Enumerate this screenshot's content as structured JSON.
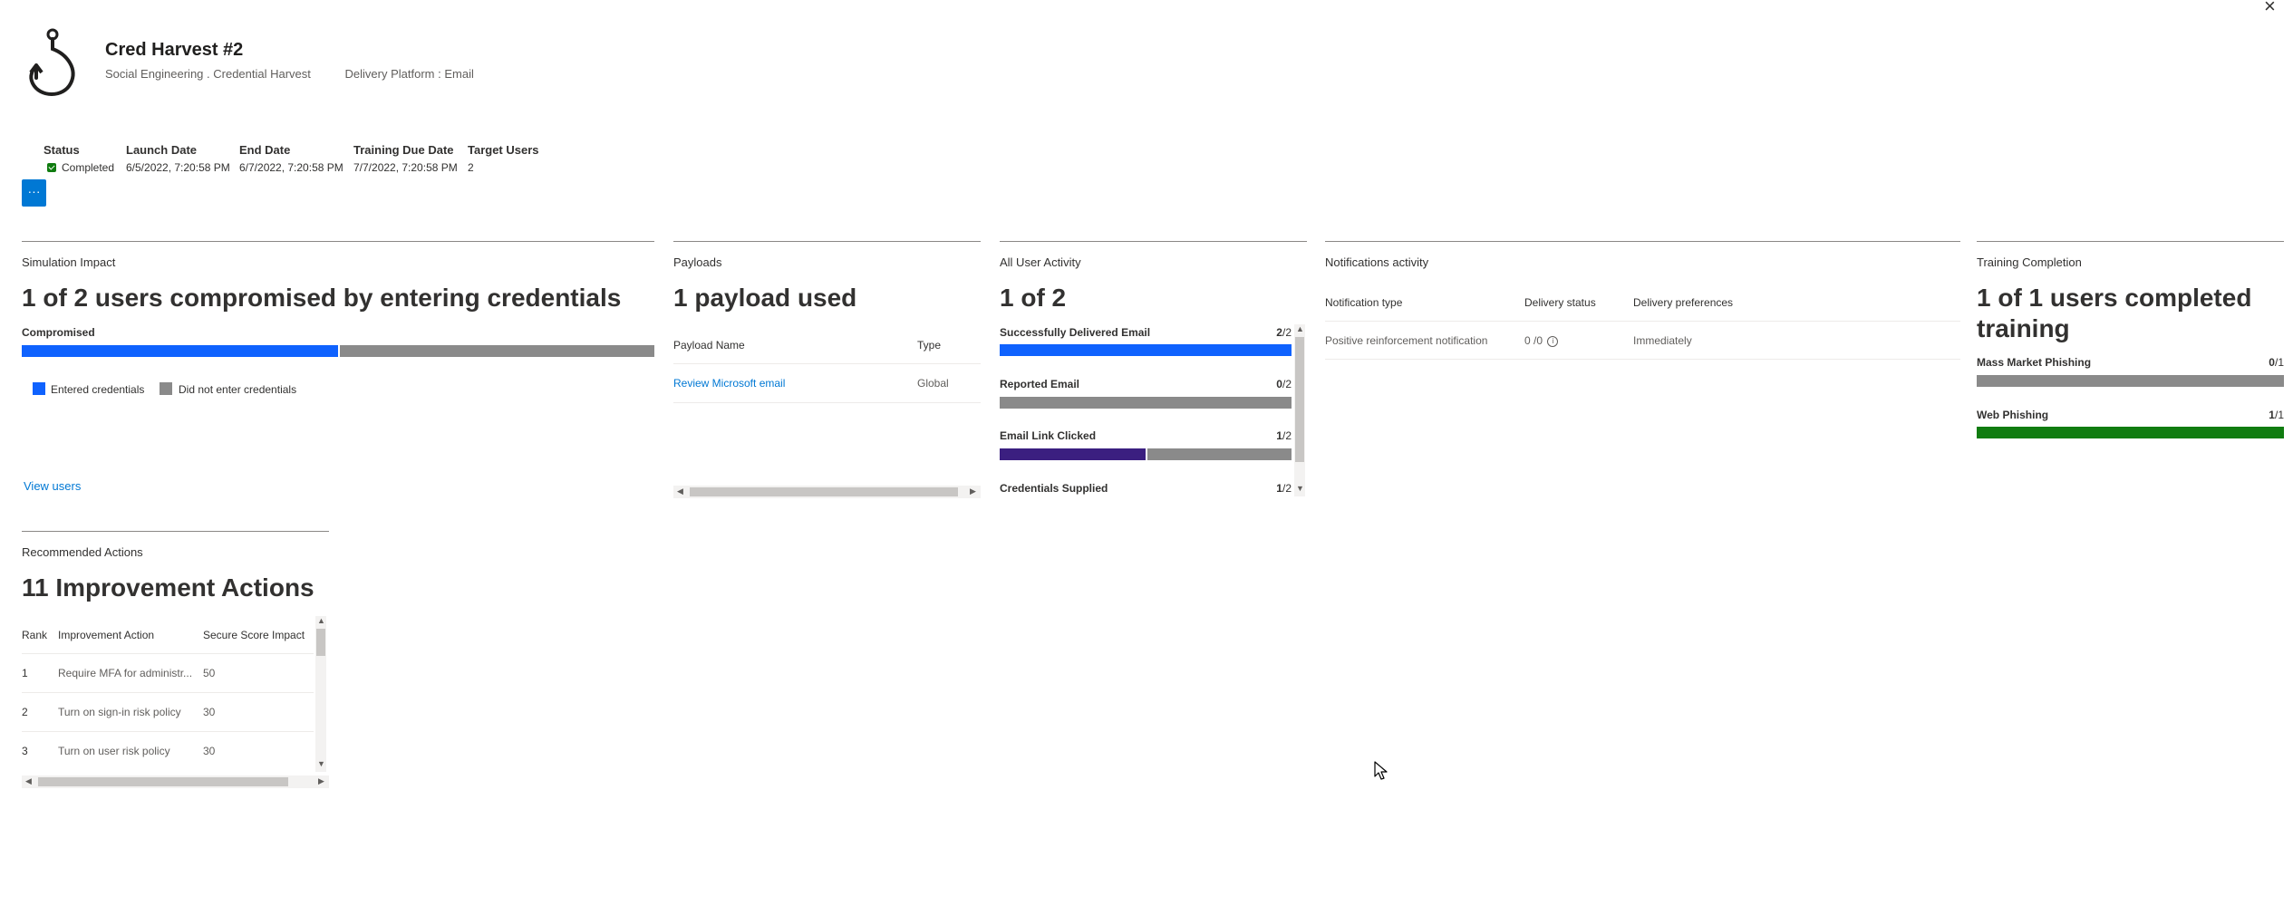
{
  "header": {
    "close": "×",
    "title": "Cred Harvest #2",
    "technique": "Social Engineering . Credential Harvest",
    "platform": "Delivery Platform : Email",
    "more": "···"
  },
  "meta": {
    "headers": [
      "Status",
      "Launch Date",
      "End Date",
      "Training Due Date",
      "Target Users"
    ],
    "status": "Completed",
    "launch": "6/5/2022, 7:20:58 PM",
    "end": "6/7/2022, 7:20:58 PM",
    "due": "7/7/2022, 7:20:58 PM",
    "target": "2"
  },
  "impact": {
    "title": "Simulation Impact",
    "headline": "1 of 2 users compromised by entering credentials",
    "bar_label": "Compromised",
    "compromised_fraction": 0.5,
    "legend_entered": "Entered credentials",
    "legend_not": "Did not enter credentials",
    "view_users": "View users"
  },
  "payloads": {
    "title": "Payloads",
    "headline": "1 payload used",
    "col_name": "Payload Name",
    "col_type": "Type",
    "row_name": "Review Microsoft email",
    "row_type": "Global"
  },
  "activity": {
    "title": "All User Activity",
    "headline": "1 of 2",
    "items": [
      {
        "label": "Successfully Delivered Email",
        "num": "2",
        "den": "/2",
        "fraction": 1.0,
        "color": "#0f62fe"
      },
      {
        "label": "Reported Email",
        "num": "0",
        "den": "/2",
        "fraction": 0.0,
        "color": "#8a8a8a"
      },
      {
        "label": "Email Link Clicked",
        "num": "1",
        "den": "/2",
        "fraction": 0.5,
        "color": "#3b1f80"
      },
      {
        "label": "Credentials Supplied",
        "num": "1",
        "den": "/2",
        "fraction": 0.5,
        "color": "#0f62fe"
      }
    ]
  },
  "notifications": {
    "title": "Notifications activity",
    "col_type": "Notification type",
    "col_status": "Delivery status",
    "col_pref": "Delivery preferences",
    "row_type": "Positive reinforcement notification",
    "row_status": "0 /0",
    "row_pref": "Immediately"
  },
  "training": {
    "title": "Training Completion",
    "headline": "1 of 1 users completed training",
    "items": [
      {
        "label": "Mass Market Phishing",
        "num": "0",
        "den": "/1",
        "fraction": 0.0,
        "color": "#8a8a8a"
      },
      {
        "label": "Web Phishing",
        "num": "1",
        "den": "/1",
        "fraction": 1.0,
        "color": "#107c10"
      }
    ]
  },
  "actions": {
    "title": "Recommended Actions",
    "headline": "11 Improvement Actions",
    "col_rank": "Rank",
    "col_action": "Improvement Action",
    "col_score": "Secure Score Impact",
    "rows": [
      {
        "rank": "1",
        "action": "Require MFA for administr...",
        "score": "50"
      },
      {
        "rank": "2",
        "action": "Turn on sign-in risk policy",
        "score": "30"
      },
      {
        "rank": "3",
        "action": "Turn on user risk policy",
        "score": "30"
      }
    ]
  },
  "colors": {
    "accent": "#0078d4",
    "entered": "#0f62fe",
    "not_entered": "#8a8a8a",
    "success": "#107c10",
    "clicked": "#3b1f80"
  }
}
